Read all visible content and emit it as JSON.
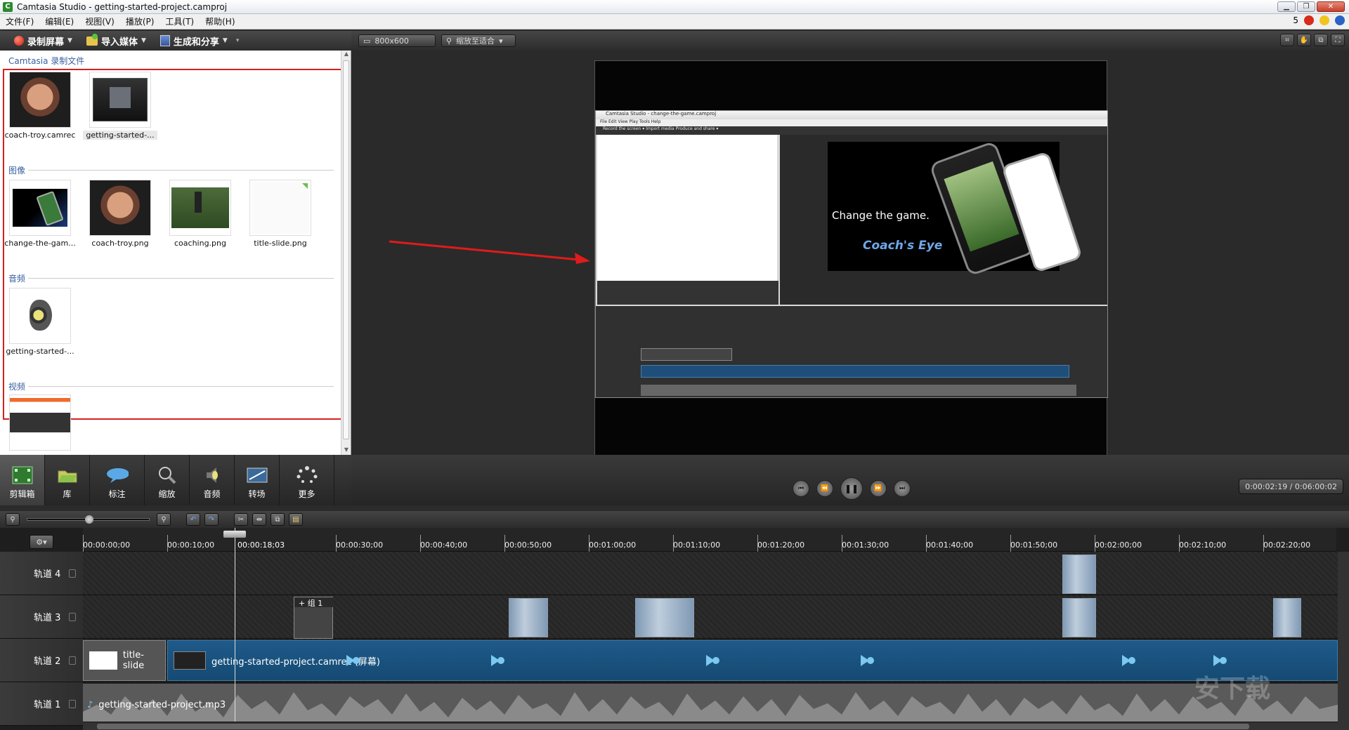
{
  "window": {
    "title": "Camtasia Studio - getting-started-project.camproj",
    "app_icon": "C"
  },
  "menu": {
    "items": [
      "文件(F)",
      "编辑(E)",
      "视图(V)",
      "播放(P)",
      "工具(T)",
      "帮助(H)"
    ],
    "notify_count": "5"
  },
  "toolbar": {
    "record": "录制屏幕",
    "import": "导入媒体",
    "produce": "生成和分享"
  },
  "clipbin": {
    "header": "Camtasia 录制文件",
    "recordings": [
      {
        "label": "coach-troy.camrec"
      },
      {
        "label": "getting-started-..."
      }
    ],
    "images_header": "图像",
    "images": [
      {
        "label": "change-the-gam..."
      },
      {
        "label": "coach-troy.png"
      },
      {
        "label": "coaching.png"
      },
      {
        "label": "title-slide.png"
      }
    ],
    "audio_header": "音频",
    "audio": [
      {
        "label": "getting-started-..."
      }
    ],
    "video_header": "视频"
  },
  "task_tabs": [
    {
      "label": "剪辑箱",
      "icon": "film-strip-icon"
    },
    {
      "label": "库",
      "icon": "library-folder-icon"
    },
    {
      "label": "标注",
      "icon": "callout-bubble-icon"
    },
    {
      "label": "缩放",
      "icon": "zoom-magnifier-icon"
    },
    {
      "label": "音频",
      "icon": "audio-speaker-icon"
    },
    {
      "label": "转场",
      "icon": "transitions-icon"
    },
    {
      "label": "更多",
      "icon": "more-dots-icon"
    }
  ],
  "preview": {
    "size": "800x600",
    "zoom": "缩放至适合",
    "time": "0:00:02:19 / 0:06:00:02",
    "inner_title": "Camtasia Studio - change-the-game.camproj",
    "inner_menu": "File  Edit  View  Play  Tools  Help",
    "inner_tool": "Record the screen ▾   Import media   Produce and share ▾",
    "stage_text": "Change the game.",
    "stage_brand": "Coach's Eye"
  },
  "timeline": {
    "ticks": [
      "00:00:00;00",
      "00:00:10;00",
      "00:00:18;03",
      "00:00:30;00",
      "00:00:40;00",
      "00:00:50;00",
      "00:01:00;00",
      "00:01:10;00",
      "00:01:20;00",
      "00:01:30;00",
      "00:01:40;00",
      "00:01:50;00",
      "00:02:00;00",
      "00:02:10;00",
      "00:02:20;00"
    ],
    "tracks": [
      {
        "label": "轨道 4"
      },
      {
        "label": "轨道 3",
        "group_label": "+ 组 1"
      },
      {
        "label": "轨道 2",
        "clip1": "title-slide",
        "clip2": "getting-started-project.camrec (屏幕)"
      },
      {
        "label": "轨道 1",
        "audio": "getting-started-project.mp3"
      }
    ]
  },
  "watermark": "安下载",
  "colors": {
    "accent_red": "#d62020",
    "clip_blue": "#1e5a8a",
    "folder_header": "#3a5fa0"
  }
}
